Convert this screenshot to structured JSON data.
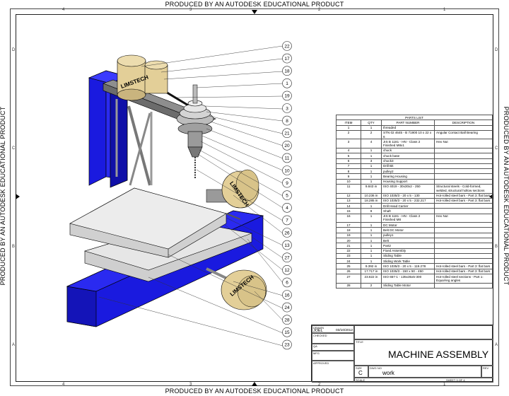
{
  "watermark": "PRODUCED BY AN AUTODESK EDUCATIONAL PRODUCT",
  "zones": {
    "columns": [
      "4",
      "3",
      "2",
      "1"
    ],
    "rows": [
      "D",
      "C",
      "B",
      "A"
    ]
  },
  "balloons": [
    "22",
    "17",
    "18",
    "1",
    "19",
    "3",
    "8",
    "21",
    "20",
    "11",
    "10",
    "9",
    "5",
    "4",
    "7",
    "26",
    "13",
    "27",
    "12",
    "6",
    "16",
    "24",
    "28",
    "15",
    "23"
  ],
  "drawing_text": {
    "logo": "LIMSTECH"
  },
  "parts_list": {
    "title": "PARTS LIST",
    "headers": [
      "ITEM",
      "QTY",
      "PART NUMBER",
      "DESCRIPTION"
    ],
    "rows": [
      [
        "1",
        "1",
        "threaded",
        ""
      ],
      [
        "2",
        "2",
        "STN 02 4645 - B 71900 10 x 22 x 6",
        "Angular Contact Ball Bearing"
      ],
      [
        "3",
        "4",
        "JIS B 1181 - HN - Class 2 Finished M8x1",
        "Hex Nut"
      ],
      [
        "4",
        "1",
        "chuck",
        ""
      ],
      [
        "5",
        "1",
        "chuck base",
        ""
      ],
      [
        "6",
        "3",
        "chuck3",
        ""
      ],
      [
        "7",
        "1",
        "Drill Bit",
        ""
      ],
      [
        "8",
        "1",
        "pulley2",
        ""
      ],
      [
        "9",
        "1",
        "Bearing Housing",
        ""
      ],
      [
        "10",
        "1",
        "Housing Support",
        ""
      ],
      [
        "11",
        "9.843 in",
        "ISO 4019 - 30x30x2 - 250",
        "Structural steels - Cold-formed, welded, structural hollow sections"
      ],
      [
        "12",
        "10.236 in",
        "ISO 1035/3 - 20 x 5 - 130",
        "Hot-rolled steel bars - Part 3: flat bars"
      ],
      [
        "13",
        "18.285 in",
        "ISO 1035/3 - 20 x 5 - 232.217",
        "Hot-rolled steel bars - Part 3: flat bars"
      ],
      [
        "14",
        "1",
        "Drill Head Carrier",
        ""
      ],
      [
        "15",
        "9",
        "Shaft",
        ""
      ],
      [
        "16",
        "1",
        "JIS B 1181 - HN - Class 2 Finished M8",
        "Hex Nut"
      ],
      [
        "17",
        "1",
        "DC Motor",
        ""
      ],
      [
        "18",
        "1",
        "Belt DC Motor",
        ""
      ],
      [
        "19",
        "1",
        "pulley1",
        ""
      ],
      [
        "20",
        "1",
        "Belt",
        ""
      ],
      [
        "21",
        "1",
        "Part2",
        ""
      ],
      [
        "22",
        "1",
        "Fixed Assembly",
        ""
      ],
      [
        "23",
        "1",
        "Sliding Table",
        ""
      ],
      [
        "24",
        "1",
        "Sliding Work Table",
        ""
      ],
      [
        "25",
        "9.392 in",
        "ISO 1035/3 - 20 x 5 - 119.278",
        "Hot-rolled steel bars - Part 3: flat bars"
      ],
      [
        "26",
        "17.717 in",
        "ISO 1035/3 - 150 x 50 - 450",
        "Hot-rolled steel bars - Part 3: flat bars"
      ],
      [
        "27",
        "23.622 in",
        "ISO 657-1 - 135x35x5-300",
        "Hot-rolled steel sections - Part 1: Equal-leg angles"
      ],
      [
        "28",
        "2",
        "Sliding Table Motor",
        ""
      ]
    ]
  },
  "title_block": {
    "drawn_label": "DRAWN",
    "drawn_by": "JOEL",
    "drawn_date": "03/10/2012",
    "checked_label": "CHECKED",
    "qa_label": "QA",
    "mfg_label": "MFG",
    "approved_label": "APPROVED",
    "title_label": "TITLE",
    "title": "MACHINE ASSEMBLY",
    "size_label": "SIZE",
    "size": "C",
    "dwg_label": "DWG NO",
    "dwg_no": "work",
    "rev_label": "REV",
    "scale_label": "SCALE",
    "sheet": "SHEET 3  OF 4"
  },
  "colors": {
    "frame_blue": "#1a1adf",
    "motor_tan": "#e3cf98",
    "table_grey": "#e0e0e0",
    "steel_grey": "#8e8e8e"
  }
}
